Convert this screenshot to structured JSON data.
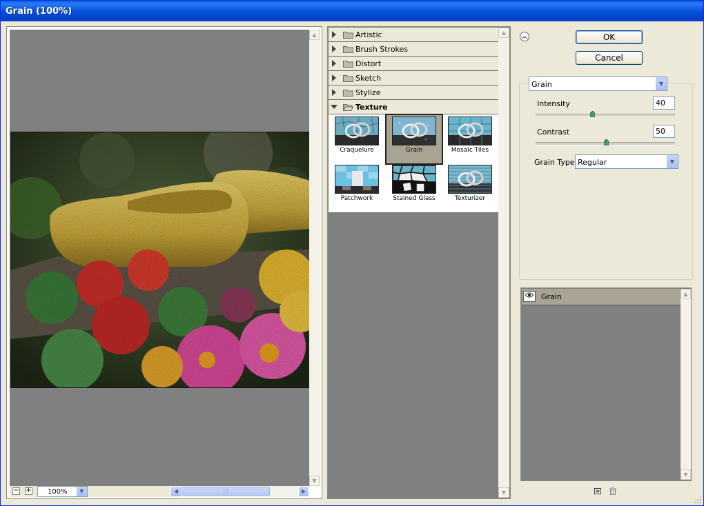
{
  "window": {
    "title": "Grain (100%)"
  },
  "preview": {
    "zoom_out_label": "−",
    "zoom_in_label": "+",
    "zoom_value": "100%"
  },
  "gallery": {
    "categories": [
      {
        "label": "Artistic",
        "expanded": false
      },
      {
        "label": "Brush Strokes",
        "expanded": false
      },
      {
        "label": "Distort",
        "expanded": false
      },
      {
        "label": "Sketch",
        "expanded": false
      },
      {
        "label": "Stylize",
        "expanded": false
      },
      {
        "label": "Texture",
        "expanded": true
      }
    ],
    "texture_filters": [
      {
        "label": "Craquelure",
        "selected": false
      },
      {
        "label": "Grain",
        "selected": true
      },
      {
        "label": "Mosaic Tiles",
        "selected": false
      },
      {
        "label": "Patchwork",
        "selected": false
      },
      {
        "label": "Stained Glass",
        "selected": false
      },
      {
        "label": "Texturizer",
        "selected": false
      }
    ]
  },
  "buttons": {
    "ok": "OK",
    "cancel": "Cancel"
  },
  "settings": {
    "filter": "Grain",
    "intensity_label": "Intensity",
    "intensity_value": "40",
    "contrast_label": "Contrast",
    "contrast_value": "50",
    "grain_type_label": "Grain Type:",
    "grain_type_value": "Regular"
  },
  "layers": {
    "items": [
      {
        "label": "Grain",
        "visible": true
      }
    ]
  },
  "icons": {
    "collapse": "double-chevron-up-icon",
    "new_layer": "new-effect-layer-icon",
    "delete": "trash-icon",
    "eye": "eye-icon"
  },
  "colors": {
    "title_bar": "#0552de",
    "dialog_bg": "#ece9d8",
    "selection": "#a8a392",
    "canvas_gray": "#808080"
  }
}
